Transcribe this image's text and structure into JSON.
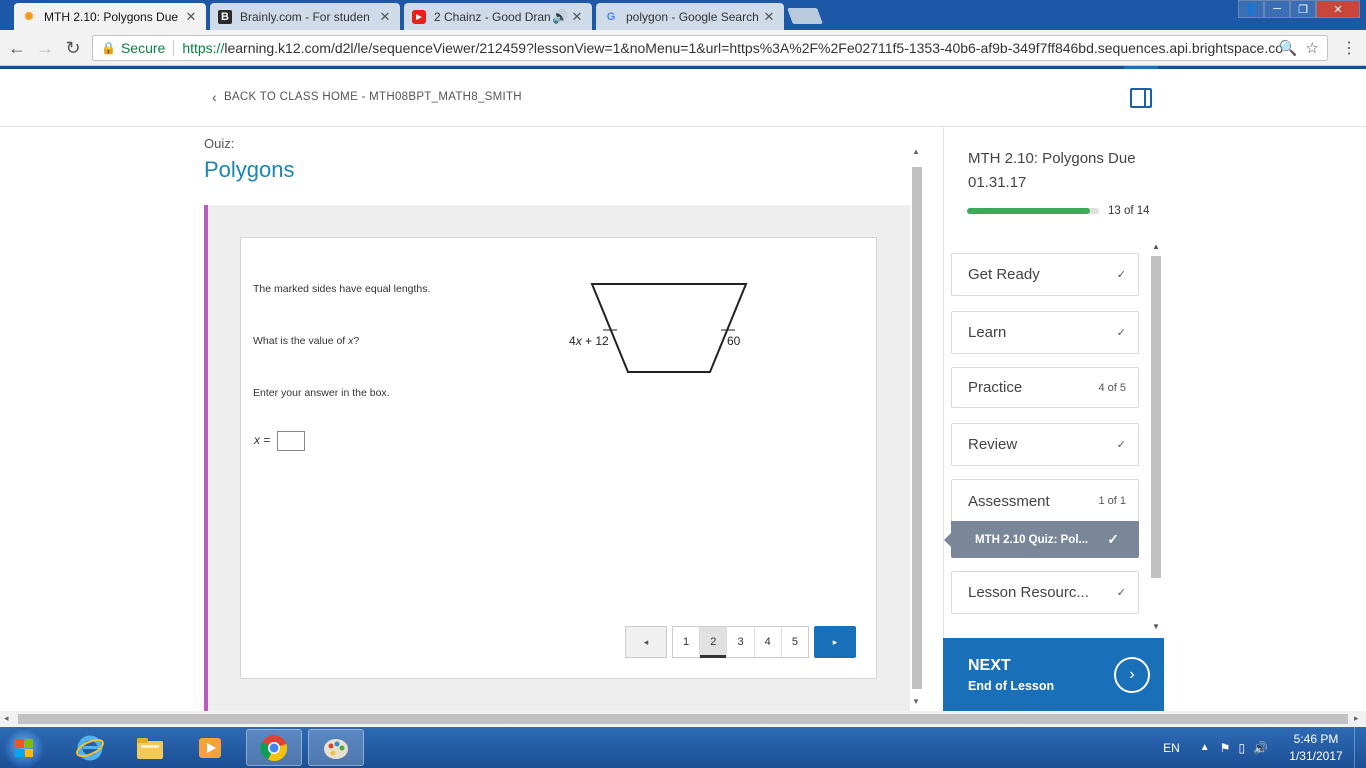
{
  "browser": {
    "tabs": [
      {
        "title": "MTH 2.10: Polygons Due",
        "icon": "k12-flower-icon",
        "active": true
      },
      {
        "title": "Brainly.com - For studen",
        "icon": "brainly-b-icon",
        "active": false
      },
      {
        "title": "2 Chainz - Good Dran",
        "icon": "youtube-icon",
        "active": false
      },
      {
        "title": "polygon - Google Search",
        "icon": "google-g-icon",
        "active": false
      }
    ],
    "secure_label": "Secure",
    "url_scheme": "https://",
    "url_rest": "learning.k12.com/d2l/le/sequenceViewer/212459?lessonView=1&noMenu=1&url=https%3A%2F%2Fe02711f5-1353-40b6-af9b-349f7ff846bd.sequences.api.brightspace.co"
  },
  "header": {
    "back_link": "BACK TO CLASS HOME - MTH08BPT_MATH8_SMITH"
  },
  "main": {
    "quiz_label": "Quiz:",
    "title": "Polygons",
    "question": {
      "line1": "The marked sides have equal lengths.",
      "line2_pre": "What is the value of ",
      "line2_var": "x",
      "line2_post": "?",
      "line3": "Enter your answer in the box.",
      "answer_var": "x",
      "answer_eq": " =",
      "answer_value": ""
    },
    "figure": {
      "left_label_coef": "4",
      "left_label_var": "x",
      "left_label_rest": " + 12",
      "right_label": "60"
    },
    "pager": {
      "prev": "◂",
      "next": "▸",
      "pages": [
        "1",
        "2",
        "3",
        "4",
        "5"
      ],
      "current_page": "2"
    }
  },
  "sidebar": {
    "lesson_title": "MTH 2.10: Polygons Due 01.31.17",
    "progress_label": "13 of 14",
    "progress_fraction": 0.93,
    "items": [
      {
        "label": "Get Ready",
        "status": "✓"
      },
      {
        "label": "Learn",
        "status": "✓"
      },
      {
        "label": "Practice",
        "status": "4 of 5"
      },
      {
        "label": "Review",
        "status": "✓"
      },
      {
        "label": "Assessment",
        "status": "1 of 1"
      },
      {
        "label": "Lesson Resourc...",
        "status": "✓"
      }
    ],
    "sub_item": {
      "label": "MTH 2.10 Quiz: Pol...",
      "status": "✓"
    },
    "next": {
      "title": "NEXT",
      "subtitle": "End of Lesson"
    }
  },
  "taskbar": {
    "language": "EN",
    "time": "5:46 PM",
    "date": "1/31/2017"
  },
  "colors": {
    "accent_blue": "#1a6fb9",
    "title_teal": "#1986b5",
    "progress_green": "#3aaa5b",
    "quiz_purple": "#b85cc0"
  }
}
